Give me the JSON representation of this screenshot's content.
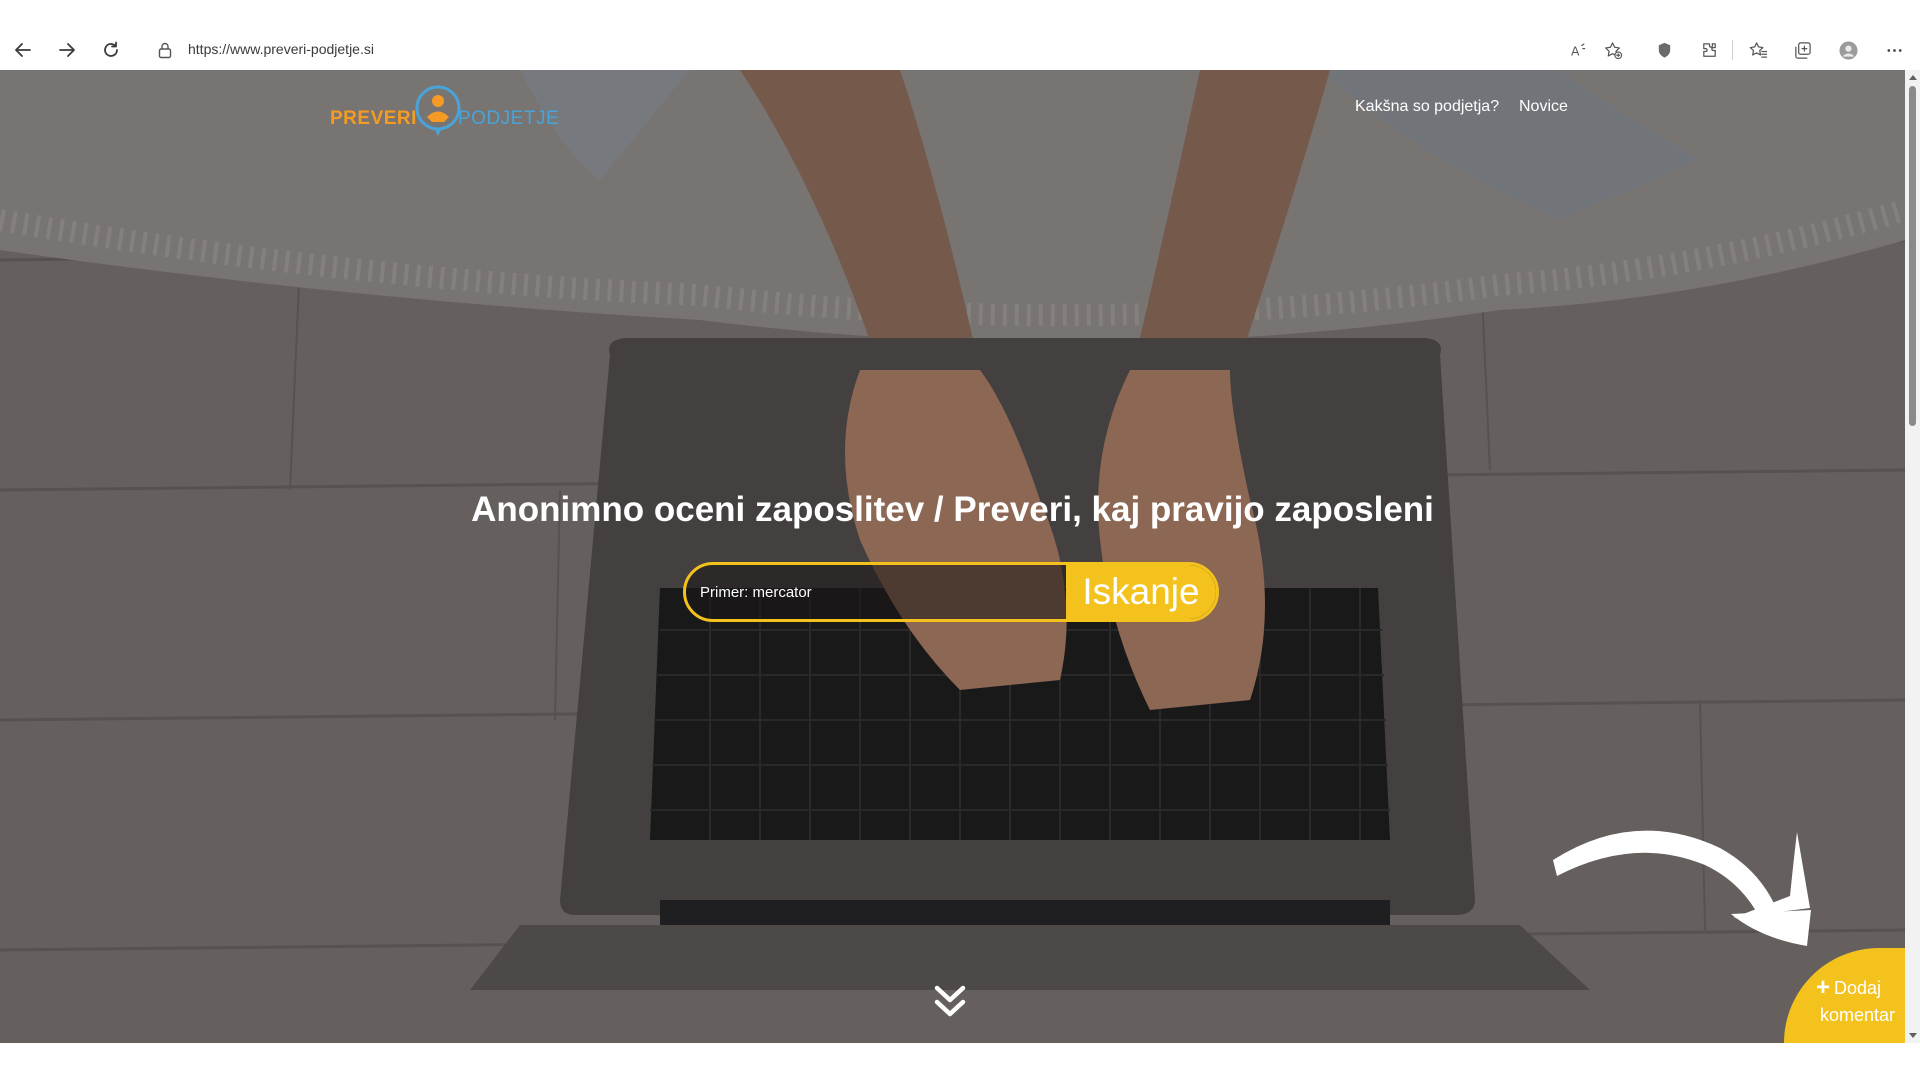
{
  "browser": {
    "url": "https://www.preveri-podjetje.si",
    "buttons": [
      "back-icon",
      "forward-icon",
      "refresh-icon"
    ],
    "toolbar_icons": [
      "read-aloud-icon",
      "add-favorite-icon",
      "shield-icon",
      "extensions-icon",
      "favorites-icon",
      "collections-icon",
      "profile-icon",
      "more-icon"
    ]
  },
  "header": {
    "logo": {
      "word_1": "PREVERI",
      "word_2": "PODJETJE"
    },
    "nav": [
      {
        "label": "Kakšna so podjetja?"
      },
      {
        "label": "Novice"
      }
    ]
  },
  "hero": {
    "title": "Anonimno oceni zaposlitev / Preveri, kaj pravijo zaposleni",
    "search": {
      "placeholder": "Primer: mercator",
      "button_label": "Iskanje"
    },
    "scroll_icon": "double-chevron-down-icon"
  },
  "add_comment": {
    "plus": "+",
    "line_1": "Dodaj",
    "line_2": "komentar"
  },
  "colors": {
    "accent": "#f4c21d",
    "logo_orange": "#f59b23",
    "logo_blue": "#4aa3d8",
    "text_light": "#ffffff"
  }
}
